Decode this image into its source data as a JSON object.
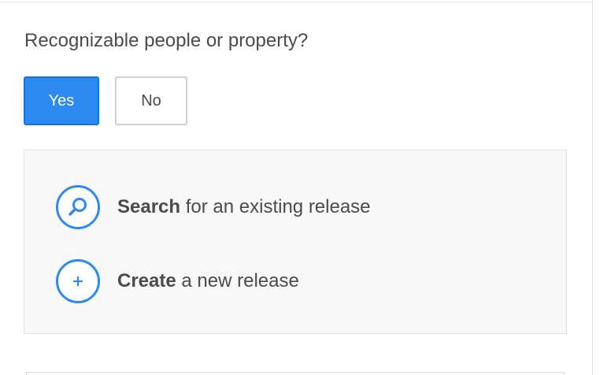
{
  "question": {
    "label": "Recognizable people or property?"
  },
  "answer_buttons": {
    "yes_label": "Yes",
    "no_label": "No",
    "selected": "Yes"
  },
  "release_options": {
    "search": {
      "bold_label": "Search",
      "rest_label": " for an existing release",
      "icon": "search-icon"
    },
    "create": {
      "bold_label": "Create",
      "rest_label": " a new release",
      "icon": "plus-icon"
    }
  },
  "colors": {
    "accent": "#2c8af1",
    "text": "#4b4b4b",
    "panel_background": "#f8f8f8"
  }
}
